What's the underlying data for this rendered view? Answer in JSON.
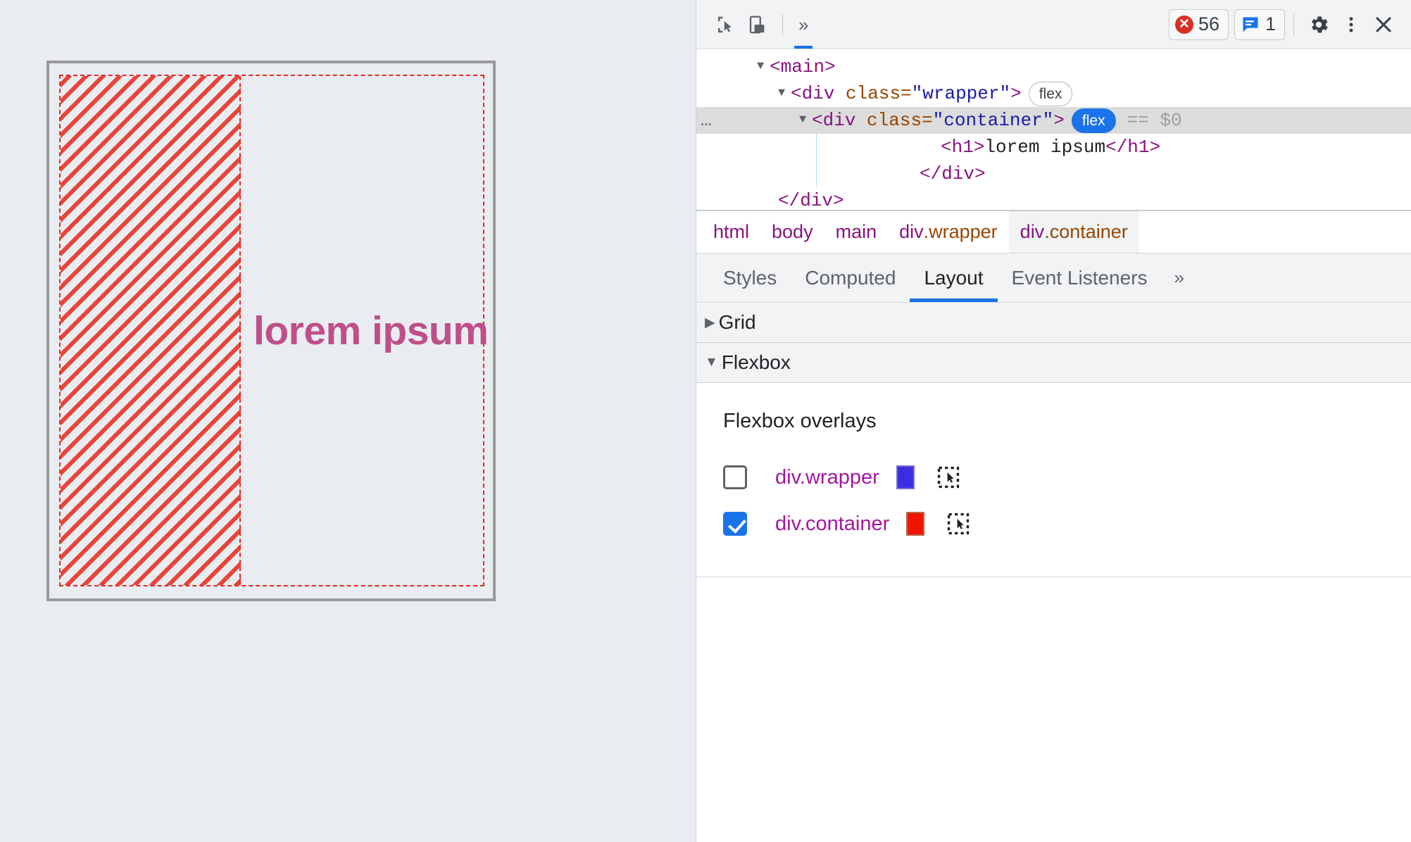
{
  "page_preview": {
    "heading_text": "lorem ipsum",
    "heading_color": "#c04e88",
    "background_color": "#e9edf2",
    "viewport_border_color": "#9a9a9a",
    "overlay_color": "#e32a1e"
  },
  "devtools": {
    "toolbar": {
      "inspect_icon": "inspect-cursor-icon",
      "device_toolbar_icon": "device-toolbar-icon",
      "more_tabs_label": "»",
      "errors": {
        "count": "56",
        "icon": "error-circle-icon"
      },
      "messages": {
        "count": "1",
        "icon": "message-bubble-icon"
      },
      "settings_icon": "gear-icon",
      "more_options_icon": "vertical-dots-icon",
      "close_icon": "close-icon"
    },
    "dom_tree": {
      "rows": [
        {
          "triangle": "▼",
          "indent": 1,
          "text": "<main>",
          "badge": "",
          "badge_active": false,
          "selected": false,
          "suffix": ""
        },
        {
          "triangle": "▼",
          "indent": 2,
          "text": "<div class=\"wrapper\">",
          "badge": "flex",
          "badge_active": false,
          "selected": false,
          "suffix": ""
        },
        {
          "triangle": "▼",
          "indent": 3,
          "text": "<div class=\"container\">",
          "badge": "flex",
          "badge_active": true,
          "selected": true,
          "suffix": "== $0",
          "dots": "…"
        },
        {
          "triangle": "",
          "indent": 4,
          "text": "<h1>lorem ipsum</h1>",
          "badge": "",
          "badge_active": false,
          "selected": false,
          "suffix": ""
        },
        {
          "triangle": "",
          "indent": 3,
          "text": "</div>",
          "badge": "",
          "badge_active": false,
          "selected": false,
          "suffix": ""
        },
        {
          "triangle": "",
          "indent": 2,
          "text": "</div>",
          "badge": "",
          "badge_active": false,
          "selected": false,
          "suffix": ""
        }
      ],
      "tag_main": "main",
      "tag_div": "div",
      "attr_class": "class",
      "val_wrapper": "\"wrapper\"",
      "val_container": "\"container\"",
      "h1_text": "lorem ipsum",
      "selected_suffix": "== $0",
      "badge_flex": "flex"
    },
    "breadcrumb": {
      "items": [
        {
          "label": "html",
          "cls": "",
          "active": false
        },
        {
          "label": "body",
          "cls": "",
          "active": false
        },
        {
          "label": "main",
          "cls": "",
          "active": false
        },
        {
          "label": "div",
          "cls": ".wrapper",
          "active": false
        },
        {
          "label": "div",
          "cls": ".container",
          "active": true
        }
      ]
    },
    "panel_tabs": {
      "items": [
        {
          "label": "Styles",
          "active": false
        },
        {
          "label": "Computed",
          "active": false
        },
        {
          "label": "Layout",
          "active": true
        },
        {
          "label": "Event Listeners",
          "active": false
        }
      ],
      "more_label": "»"
    },
    "layout_panel": {
      "grid_section": {
        "title": "Grid",
        "expanded": false,
        "triangle": "▶"
      },
      "flexbox_section": {
        "title": "Flexbox",
        "expanded": true,
        "triangle": "▼"
      },
      "flexbox_overlays_title": "Flexbox overlays",
      "overlays": [
        {
          "label": "div.wrapper",
          "checked": false,
          "color": "#3b2ee0",
          "reveal_icon": "reveal-element-icon"
        },
        {
          "label": "div.container",
          "checked": true,
          "color": "#f01500",
          "reveal_icon": "reveal-element-icon"
        }
      ]
    }
  }
}
